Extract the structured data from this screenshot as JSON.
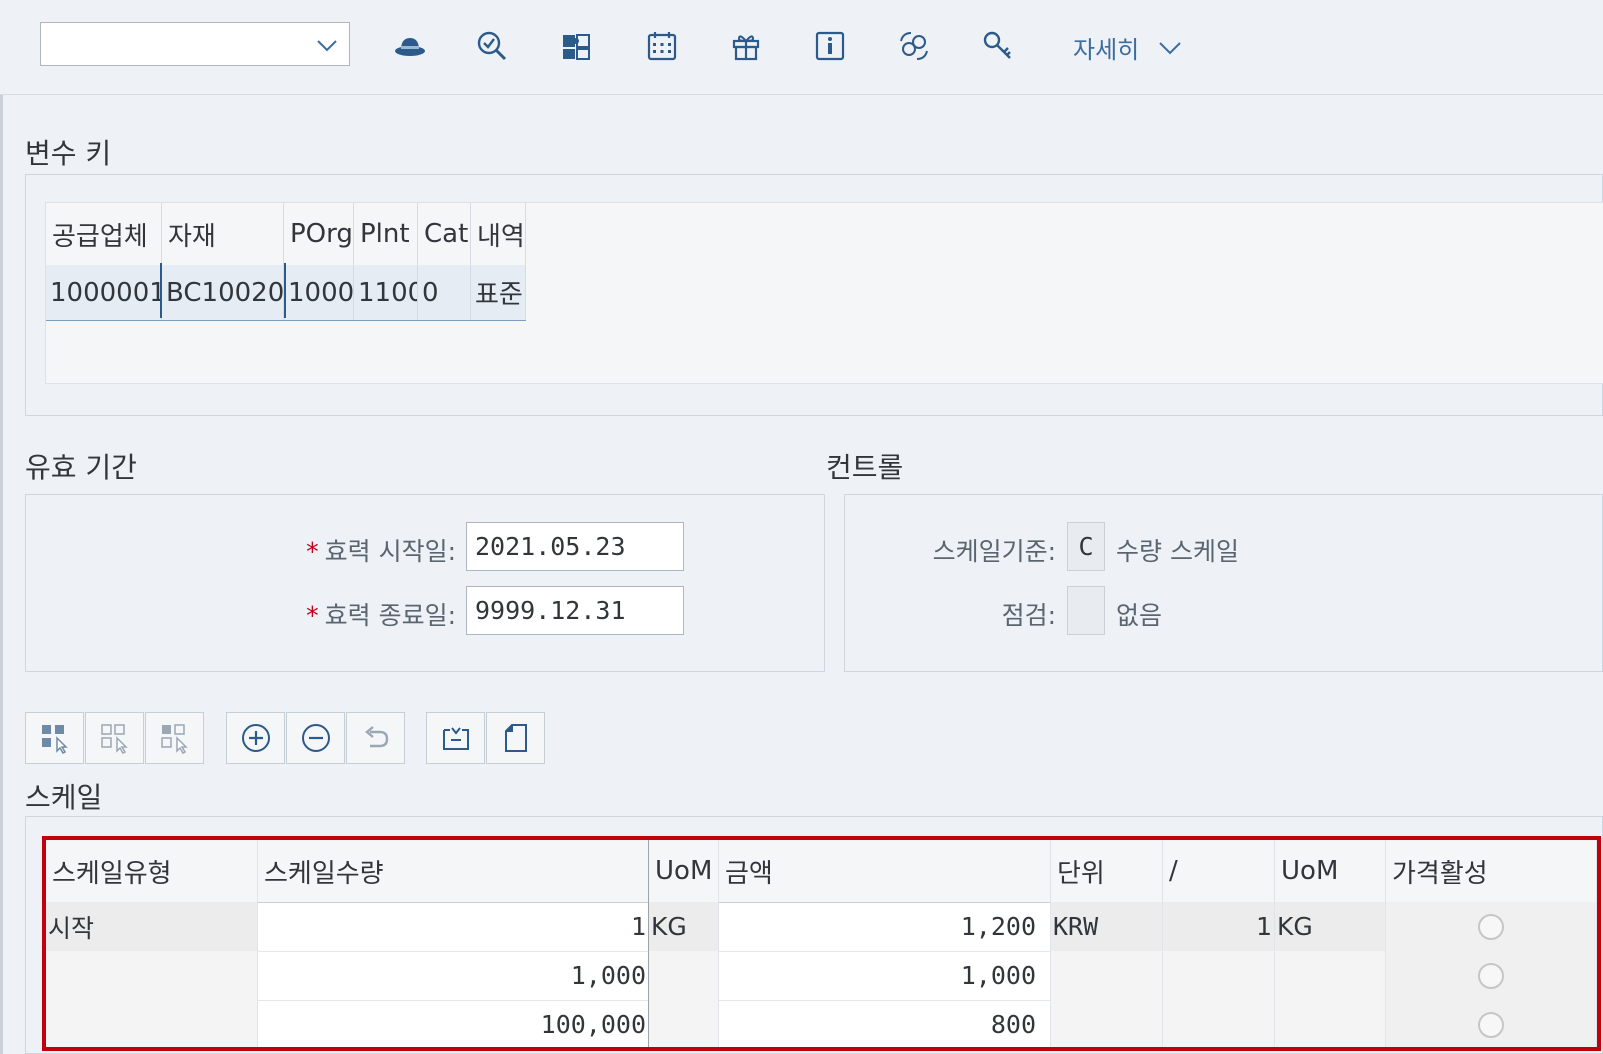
{
  "toolbar": {
    "dropdown_value": "",
    "icons": [
      "hat-icon",
      "check-search-icon",
      "puzzle-icon",
      "calendar-icon",
      "gift-icon",
      "info-icon",
      "money-cycle-icon",
      "key-icon"
    ],
    "more_label": "자세히"
  },
  "variable_key": {
    "title": "변수 키",
    "columns": [
      "공급업체",
      "자재",
      "POrg",
      "Plnt",
      "Cat",
      "내역"
    ],
    "row": [
      "1000001",
      "BC10020",
      "1000",
      "1100",
      "0",
      "표준"
    ]
  },
  "validity": {
    "title": "유효 기간",
    "start_label": "효력 시작일:",
    "start_value": "2021.05.23",
    "end_label": "효력 종료일:",
    "end_value": "9999.12.31"
  },
  "control": {
    "title": "컨트롤",
    "scale_basis_label": "스케일기준:",
    "scale_basis_value": "C",
    "scale_basis_text": "수량 스케일",
    "check_label": "점검:",
    "check_value": "",
    "check_text": "없음"
  },
  "scale": {
    "title": "스케일",
    "columns": [
      "스케일유형",
      "스케일수량",
      "UoM",
      "금액",
      "단위",
      "/",
      "UoM",
      "가격활성"
    ],
    "rows": [
      {
        "type": "시작",
        "qty": "1",
        "uom": "KG",
        "amount": "1,200",
        "unit": "KRW",
        "per": "1",
        "uom2": "KG"
      },
      {
        "type": "",
        "qty": "1,000",
        "uom": "",
        "amount": "1,000",
        "unit": "",
        "per": "",
        "uom2": ""
      },
      {
        "type": "",
        "qty": "100,000",
        "uom": "",
        "amount": "800",
        "unit": "",
        "per": "",
        "uom2": ""
      }
    ]
  }
}
